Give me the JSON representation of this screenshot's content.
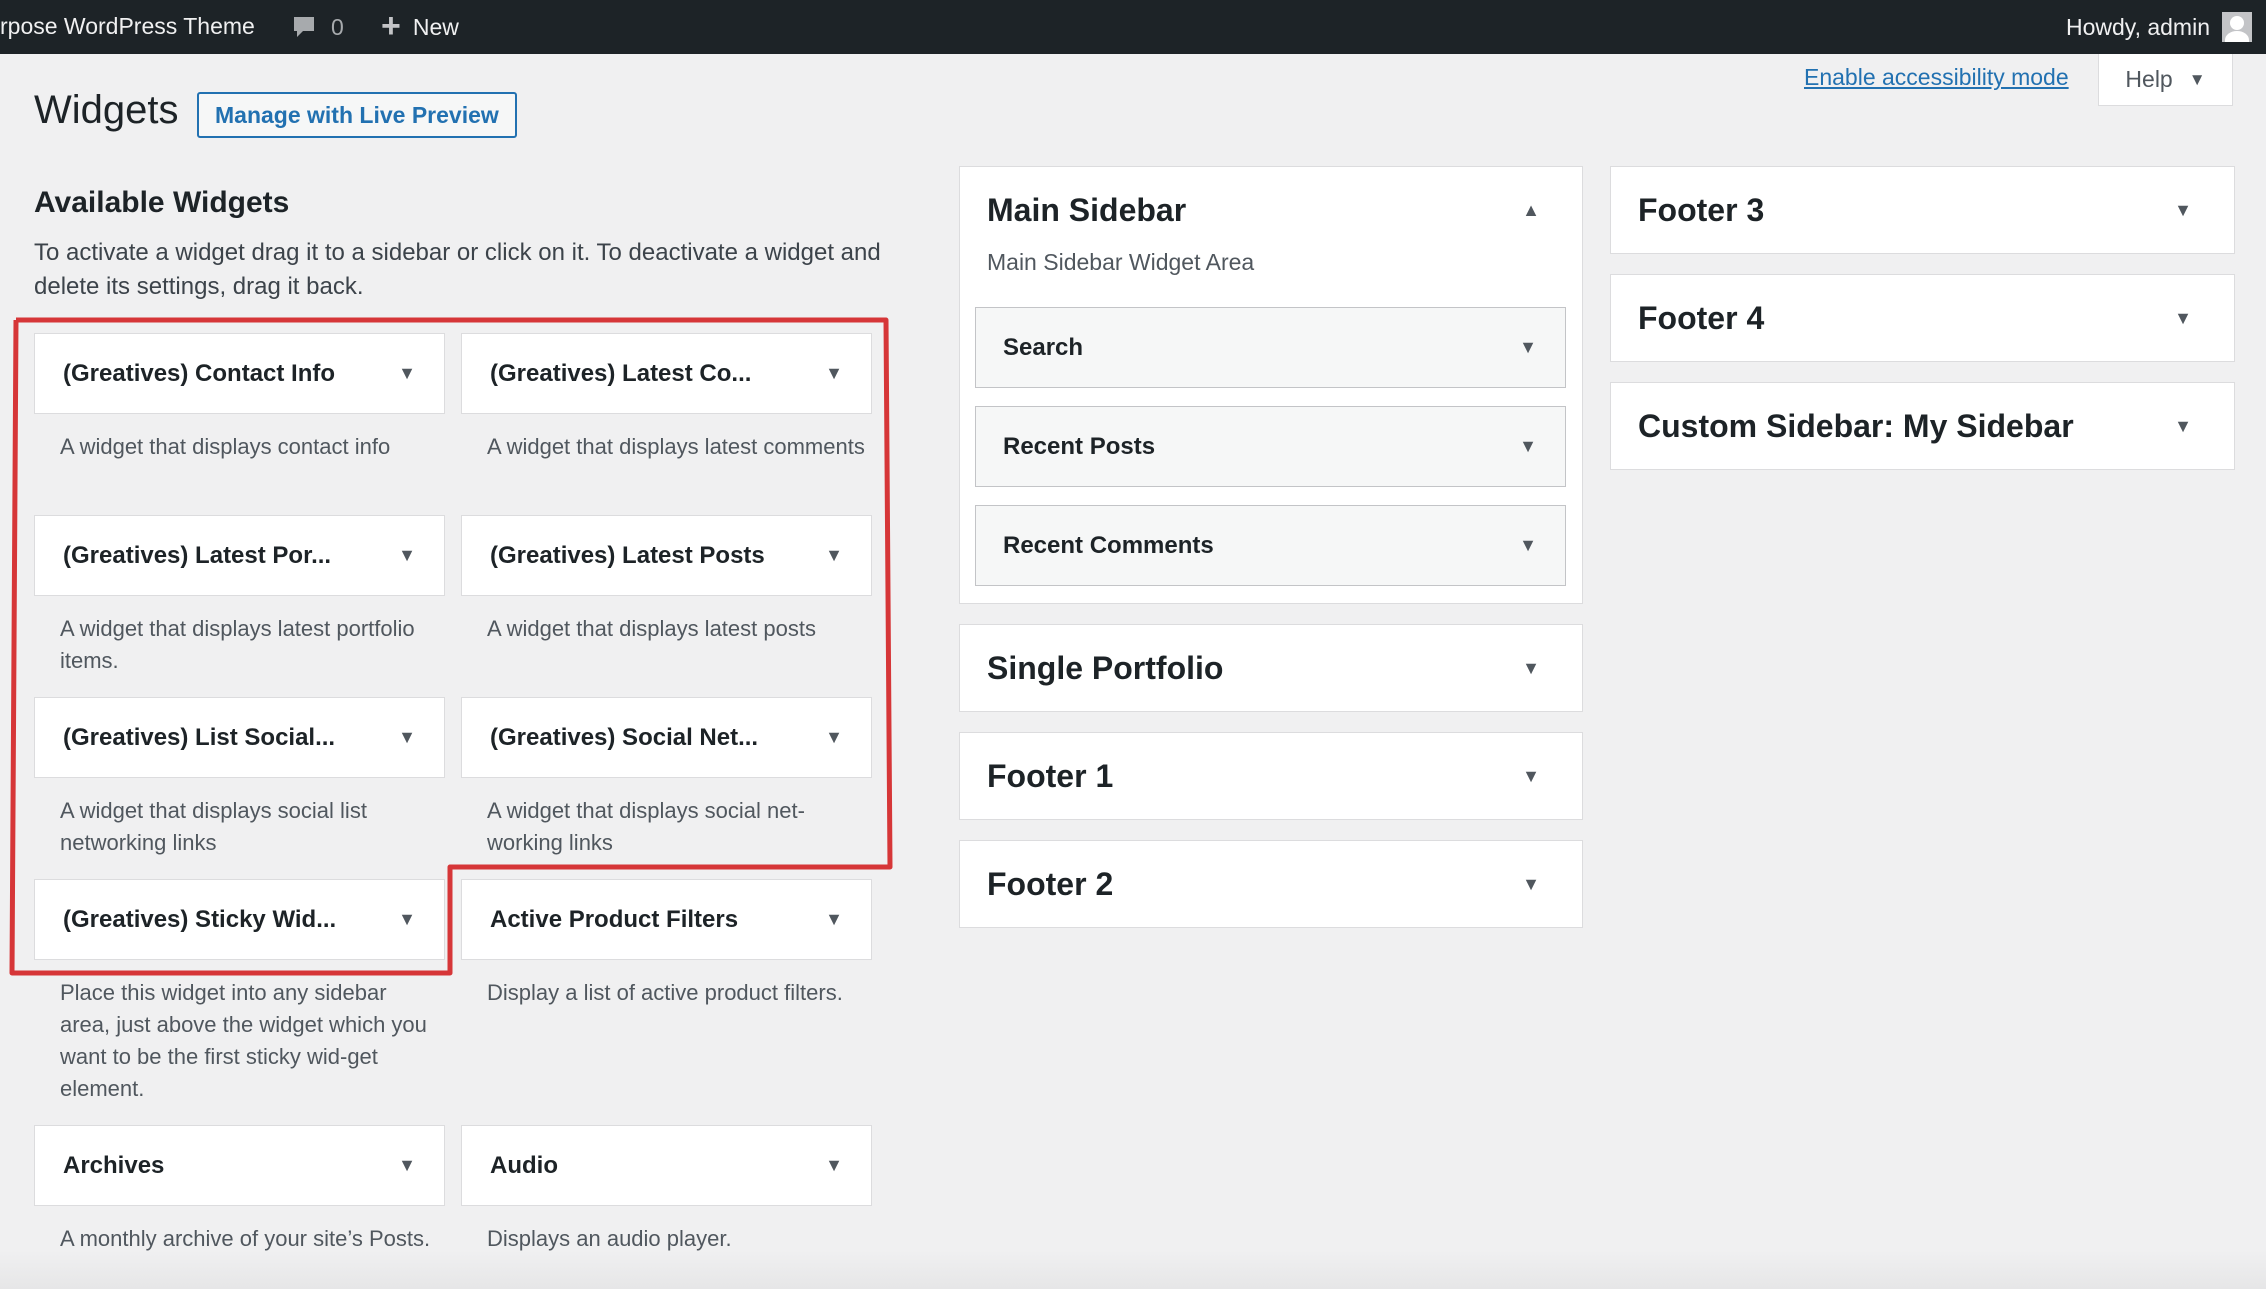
{
  "admin_bar": {
    "site_name": "rpose WordPress Theme",
    "comments_count": "0",
    "new_label": "New",
    "howdy": "Howdy, admin"
  },
  "screen_meta": {
    "accessibility_link": "Enable accessibility mode",
    "help_label": "Help"
  },
  "page": {
    "title": "Widgets",
    "live_preview_button": "Manage with Live Preview"
  },
  "available": {
    "title": "Available Widgets",
    "description": "To activate a widget drag it to a sidebar or click on it. To deactivate a widget and delete its settings, drag it back.",
    "widgets": [
      {
        "title": "(Greatives) Contact Info",
        "description": "A widget that displays contact info"
      },
      {
        "title": "(Greatives) Latest Co...",
        "description": "A widget that displays latest comments"
      },
      {
        "title": "(Greatives) Latest Por...",
        "description": "A widget that displays latest portfolio items."
      },
      {
        "title": "(Greatives) Latest Posts",
        "description": "A widget that displays latest posts"
      },
      {
        "title": "(Greatives) List Social...",
        "description": "A widget that displays social list networking links"
      },
      {
        "title": "(Greatives) Social Net...",
        "description": "A widget that displays social net-working links"
      },
      {
        "title": "(Greatives) Sticky Wid...",
        "description": "Place this widget into any sidebar area, just above the widget which you want to be the first sticky wid-get element."
      },
      {
        "title": "Active Product Filters",
        "description": "Display a list of active product filters."
      },
      {
        "title": "Archives",
        "description": "A monthly archive of your site’s Posts."
      },
      {
        "title": "Audio",
        "description": "Displays an audio player."
      }
    ]
  },
  "sidebars": {
    "main": {
      "title": "Main Sidebar",
      "description": "Main Sidebar Widget Area",
      "widgets": [
        "Search",
        "Recent Posts",
        "Recent Comments"
      ]
    },
    "single_portfolio": "Single Portfolio",
    "footer1": "Footer 1",
    "footer2": "Footer 2",
    "footer3": "Footer 3",
    "footer4": "Footer 4",
    "custom": "Custom Sidebar: My Sidebar"
  },
  "icons": {
    "comment": "comment-bubble-icon",
    "plus": "plus-icon",
    "avatar": "user-avatar-icon",
    "collapse": "triangle-down-icon",
    "expand": "triangle-up-icon"
  },
  "colors": {
    "admin_bar": "#1d2327",
    "link": "#2271b1",
    "highlight": "#d63638",
    "background": "#f0f0f1"
  }
}
